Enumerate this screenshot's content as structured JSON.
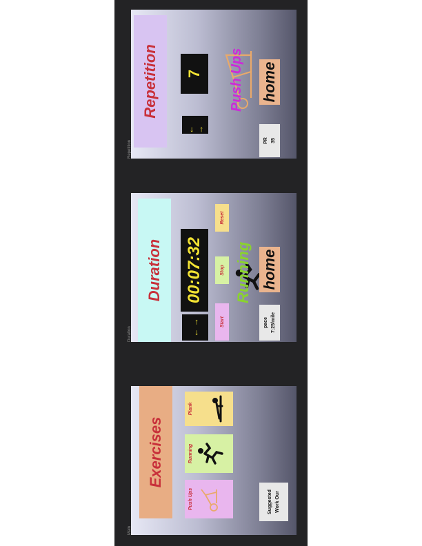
{
  "screens": {
    "main": {
      "frame_label": "Main",
      "title": "Exercises",
      "cards": [
        {
          "label": "Push Ups",
          "icon": "pushup-icon"
        },
        {
          "label": "Running",
          "icon": "running-icon"
        },
        {
          "label": "Plank",
          "icon": "plank-icon"
        }
      ],
      "suggested": "Suggested Work Our"
    },
    "duration": {
      "frame_label": "Duration",
      "title": "Duration",
      "time": "00:07:32",
      "arrows": "← →",
      "start": "Start",
      "stop": "Stop",
      "reset": "Reset",
      "activity": "Running",
      "pace_label": "pace",
      "pace_value": "7:25/mile",
      "home": "home"
    },
    "repetition": {
      "frame_label": "Repetition",
      "title": "Repetition",
      "count": "7",
      "arrows": "← →",
      "activity": "Push Ups",
      "pr_label": "PR",
      "pr_value": "35",
      "home": "home"
    }
  },
  "colors": {
    "title_text": "#c8303a",
    "exercises_header": "#e8ad84",
    "duration_header": "#c8f8f4",
    "repetition_header": "#d8c4f2",
    "pushups_card": "#e9b6ee",
    "running_card": "#d7f1a4",
    "plank_card": "#f6df8c",
    "display_bg": "#111111",
    "display_text": "#f2e233",
    "home_button": "#eab48e",
    "running_text": "#8ad32d",
    "pushups_text": "#cc2bd8"
  }
}
